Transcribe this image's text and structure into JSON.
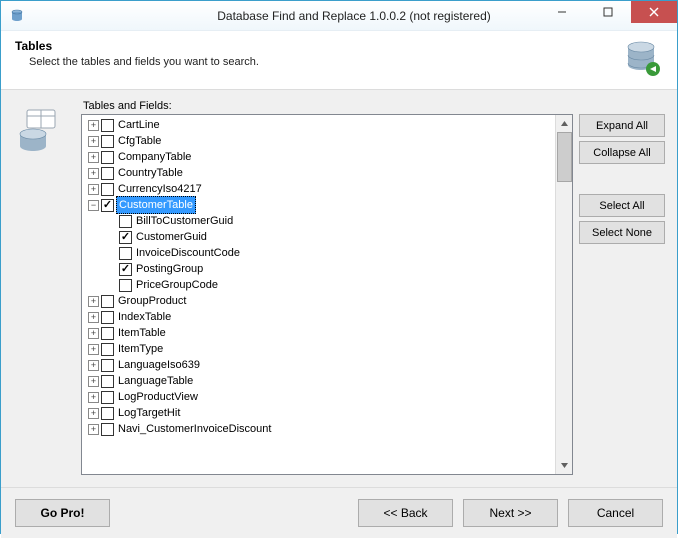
{
  "window": {
    "title": "Database Find and Replace 1.0.0.2 (not registered)"
  },
  "header": {
    "title": "Tables",
    "subtitle": "Select the tables and fields you want to search."
  },
  "tree_label": "Tables and Fields:",
  "side_buttons": {
    "expand_all": "Expand All",
    "collapse_all": "Collapse All",
    "select_all": "Select All",
    "select_none": "Select None"
  },
  "tree": {
    "selected": "CustomerTable",
    "nodes": [
      {
        "label": "CartLine",
        "expanded": false,
        "checked": false
      },
      {
        "label": "CfgTable",
        "expanded": false,
        "checked": false
      },
      {
        "label": "CompanyTable",
        "expanded": false,
        "checked": false
      },
      {
        "label": "CountryTable",
        "expanded": false,
        "checked": false
      },
      {
        "label": "CurrencyIso4217",
        "expanded": false,
        "checked": false
      },
      {
        "label": "CustomerTable",
        "expanded": true,
        "checked": true,
        "children": [
          {
            "label": "BillToCustomerGuid",
            "checked": false
          },
          {
            "label": "CustomerGuid",
            "checked": true
          },
          {
            "label": "InvoiceDiscountCode",
            "checked": false
          },
          {
            "label": "PostingGroup",
            "checked": true
          },
          {
            "label": "PriceGroupCode",
            "checked": false
          }
        ]
      },
      {
        "label": "GroupProduct",
        "expanded": false,
        "checked": false
      },
      {
        "label": "IndexTable",
        "expanded": false,
        "checked": false
      },
      {
        "label": "ItemTable",
        "expanded": false,
        "checked": false
      },
      {
        "label": "ItemType",
        "expanded": false,
        "checked": false
      },
      {
        "label": "LanguageIso639",
        "expanded": false,
        "checked": false
      },
      {
        "label": "LanguageTable",
        "expanded": false,
        "checked": false
      },
      {
        "label": "LogProductView",
        "expanded": false,
        "checked": false
      },
      {
        "label": "LogTargetHit",
        "expanded": false,
        "checked": false
      },
      {
        "label": "Navi_CustomerInvoiceDiscount",
        "expanded": false,
        "checked": false
      }
    ]
  },
  "footer": {
    "go_pro": "Go Pro!",
    "back": "<< Back",
    "next": "Next >>",
    "cancel": "Cancel"
  }
}
